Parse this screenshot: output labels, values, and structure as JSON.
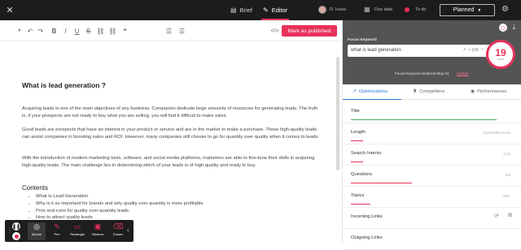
{
  "topbar": {
    "tab_brief": "Brief",
    "tab_editor": "Editor",
    "user_name": "R. Iussa",
    "due_date_label": "Due date",
    "todo_label": "To do",
    "planned_label": "Planned"
  },
  "toolbar": {
    "paragraph_select_icon": "chevron-down-icon",
    "publish_label": "Mark as published"
  },
  "editor": {
    "heading": "What is lead generation ?",
    "p1": "Acquiring leads is one of the main objectives of any business. Companies dedicate large amounts of resources for generating leads. The truth is, if your prospects are not ready to buy what you are selling, you will find it difficult to make sales.",
    "p2": "Good leads are prospects that have an interest in your product or service and are in the market to make a purchase. These high-quality leads can assist companies in boosting sales and ROI. However, many companies still choose to go for quantity over quality when it comes to leads.",
    "p3": "With the introduction of modern marketing tools, software, and social media platforms, marketers are able to fine-tune their skills in acquiring high-quality leads. The main challenge lies in determining which of your leads is of high quality and ready to buy.",
    "contents_heading": "Contents",
    "contents": [
      "What Is Lead Generation",
      "Why is it so important for brands and why quality over quantity is more profitable",
      "Pros and cons for quality over quantity leads",
      "How to attract quality leads"
    ]
  },
  "floatbar": {
    "mouse": "Mouse",
    "pen": "Pen",
    "rectangle": "Rectangle",
    "stickers": "Stickers",
    "eraser": "Eraser"
  },
  "keyword_panel": {
    "label": "Focus Keyword",
    "keyword": "what is lead generation",
    "volume": "> 100",
    "results": "2K",
    "analyzed_note": "Focus Keyword analyzed May 04.",
    "update_link": "Update",
    "score": "19",
    "score_sub": "score"
  },
  "panel_tabs": {
    "optimizations": "Optimizations",
    "competitors": "Competitors",
    "performances": "Performances"
  },
  "opt_rows": [
    {
      "title": "Title",
      "count": "",
      "fill": 0.95,
      "color": "green"
    },
    {
      "title": "Length",
      "count": "234/3,000 words",
      "fill": 0.08,
      "color": "red"
    },
    {
      "title": "Search Intents",
      "count": "1/12",
      "fill": 0.08,
      "color": "red"
    },
    {
      "title": "Questions",
      "count": "2/5",
      "fill": 0.4,
      "color": "red"
    },
    {
      "title": "Topics",
      "count": "6/47",
      "fill": 0.13,
      "color": "red"
    },
    {
      "title": "Incoming Links",
      "count": "",
      "fill": 0,
      "color": "red"
    },
    {
      "title": "Outgoing Links",
      "count": "",
      "fill": 0,
      "color": "red"
    }
  ],
  "colors": {
    "accent": "#e8315b",
    "topbar_bg": "#1c1c1c",
    "active_tab": "#2f7ad8",
    "good": "#4caf50"
  }
}
